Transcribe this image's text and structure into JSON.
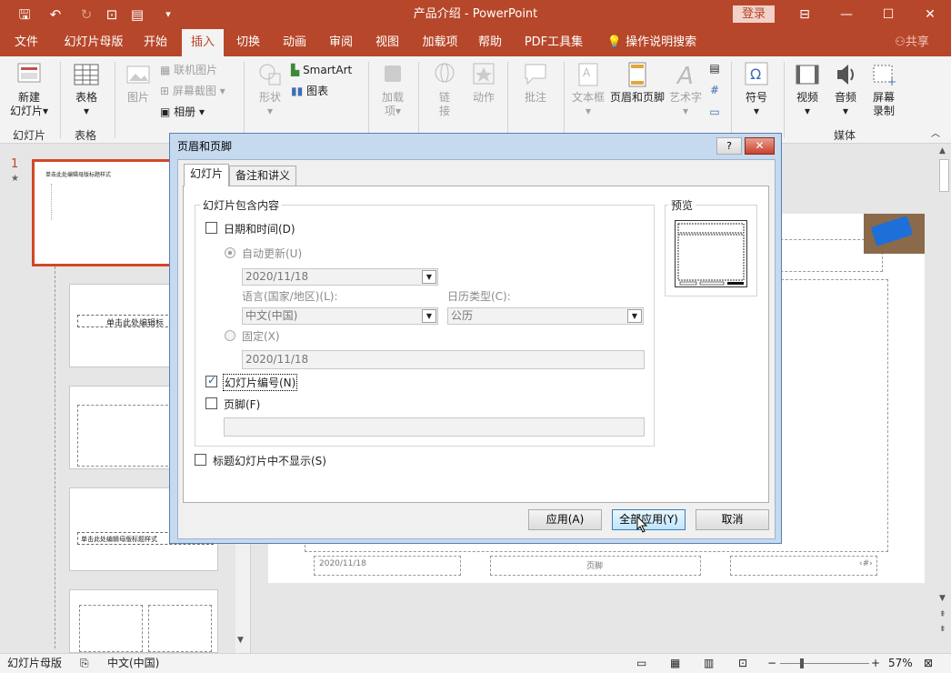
{
  "app": {
    "doc_title": "产品介绍",
    "app_name": "PowerPoint",
    "title_sep": " - ",
    "login": "登录",
    "share": "共享",
    "tell_me": "操作说明搜索"
  },
  "tabs": [
    "文件",
    "幻灯片母版",
    "开始",
    "插入",
    "切换",
    "动画",
    "审阅",
    "视图",
    "加载项",
    "帮助",
    "PDF工具集"
  ],
  "active_tab": "插入",
  "ribbon": {
    "new_slide": "新建",
    "new_slide2": "幻灯片",
    "table": "表格",
    "picture": "图片",
    "online_picture": "联机图片",
    "screenshot": "屏幕截图",
    "album": "相册",
    "shapes": "形状",
    "smartart": "SmartArt",
    "chart": "图表",
    "addins": "加载",
    "addins2": "项",
    "link": "链",
    "link2": "接",
    "action": "动作",
    "comment": "批注",
    "textbox": "文本框",
    "header_footer": "页眉和页脚",
    "wordart": "艺术字",
    "symbol": "符号",
    "video": "视频",
    "audio": "音频",
    "screen_rec": "屏幕",
    "screen_rec2": "录制",
    "groups": {
      "slides": "幻灯片",
      "tables": "表格",
      "media": "媒体"
    }
  },
  "thumbs": {
    "first_num": "1",
    "master_title": "单击此处编辑母版标题样式",
    "layout_title": "单击此处编辑标",
    "layout_sub": "单击此处编辑标",
    "t4_title": "单击此处编辑母版标题样式"
  },
  "slide_footer": {
    "date": "2020/11/18",
    "footer": "页脚",
    "number": "‹#›"
  },
  "dialog": {
    "title": "页眉和页脚",
    "help": "?",
    "close": "✕",
    "tab_slide": "幻灯片",
    "tab_notes": "备注和讲义",
    "include_legend": "幻灯片包含内容",
    "date_time": "日期和时间(D)",
    "auto_update": "自动更新(U)",
    "date_value": "2020/11/18",
    "language_label": "语言(国家/地区)(L):",
    "language_value": "中文(中国)",
    "calendar_label": "日历类型(C):",
    "calendar_value": "公历",
    "fixed": "固定(X)",
    "fixed_value": "2020/11/18",
    "slide_number": "幻灯片编号(N)",
    "footer": "页脚(F)",
    "footer_value": "",
    "no_title_slide": "标题幻灯片中不显示(S)",
    "preview": "预览",
    "apply": "应用(A)",
    "apply_all": "全部应用(Y)",
    "cancel": "取消"
  },
  "status": {
    "view": "幻灯片母版",
    "language": "中文(中国)",
    "zoom": "57%"
  }
}
